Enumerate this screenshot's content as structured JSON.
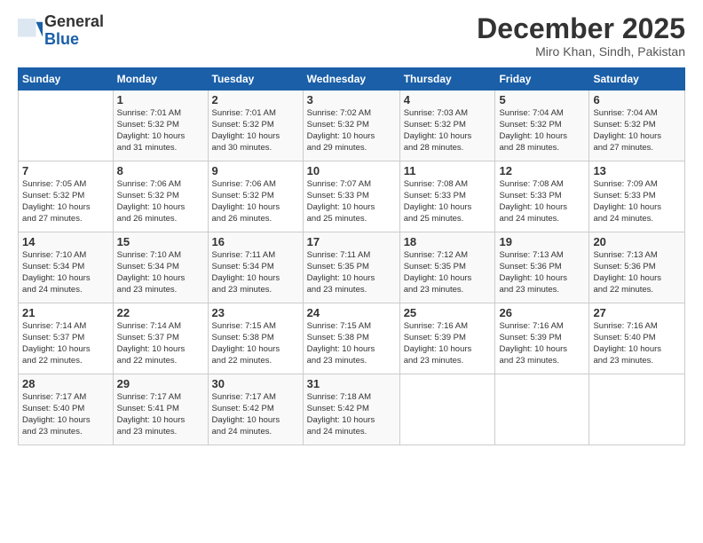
{
  "logo": {
    "general": "General",
    "blue": "Blue"
  },
  "header": {
    "month": "December 2025",
    "location": "Miro Khan, Sindh, Pakistan"
  },
  "days_of_week": [
    "Sunday",
    "Monday",
    "Tuesday",
    "Wednesday",
    "Thursday",
    "Friday",
    "Saturday"
  ],
  "weeks": [
    [
      {
        "day": "",
        "info": ""
      },
      {
        "day": "1",
        "info": "Sunrise: 7:01 AM\nSunset: 5:32 PM\nDaylight: 10 hours\nand 31 minutes."
      },
      {
        "day": "2",
        "info": "Sunrise: 7:01 AM\nSunset: 5:32 PM\nDaylight: 10 hours\nand 30 minutes."
      },
      {
        "day": "3",
        "info": "Sunrise: 7:02 AM\nSunset: 5:32 PM\nDaylight: 10 hours\nand 29 minutes."
      },
      {
        "day": "4",
        "info": "Sunrise: 7:03 AM\nSunset: 5:32 PM\nDaylight: 10 hours\nand 28 minutes."
      },
      {
        "day": "5",
        "info": "Sunrise: 7:04 AM\nSunset: 5:32 PM\nDaylight: 10 hours\nand 28 minutes."
      },
      {
        "day": "6",
        "info": "Sunrise: 7:04 AM\nSunset: 5:32 PM\nDaylight: 10 hours\nand 27 minutes."
      }
    ],
    [
      {
        "day": "7",
        "info": "Sunrise: 7:05 AM\nSunset: 5:32 PM\nDaylight: 10 hours\nand 27 minutes."
      },
      {
        "day": "8",
        "info": "Sunrise: 7:06 AM\nSunset: 5:32 PM\nDaylight: 10 hours\nand 26 minutes."
      },
      {
        "day": "9",
        "info": "Sunrise: 7:06 AM\nSunset: 5:32 PM\nDaylight: 10 hours\nand 26 minutes."
      },
      {
        "day": "10",
        "info": "Sunrise: 7:07 AM\nSunset: 5:33 PM\nDaylight: 10 hours\nand 25 minutes."
      },
      {
        "day": "11",
        "info": "Sunrise: 7:08 AM\nSunset: 5:33 PM\nDaylight: 10 hours\nand 25 minutes."
      },
      {
        "day": "12",
        "info": "Sunrise: 7:08 AM\nSunset: 5:33 PM\nDaylight: 10 hours\nand 24 minutes."
      },
      {
        "day": "13",
        "info": "Sunrise: 7:09 AM\nSunset: 5:33 PM\nDaylight: 10 hours\nand 24 minutes."
      }
    ],
    [
      {
        "day": "14",
        "info": "Sunrise: 7:10 AM\nSunset: 5:34 PM\nDaylight: 10 hours\nand 24 minutes."
      },
      {
        "day": "15",
        "info": "Sunrise: 7:10 AM\nSunset: 5:34 PM\nDaylight: 10 hours\nand 23 minutes."
      },
      {
        "day": "16",
        "info": "Sunrise: 7:11 AM\nSunset: 5:34 PM\nDaylight: 10 hours\nand 23 minutes."
      },
      {
        "day": "17",
        "info": "Sunrise: 7:11 AM\nSunset: 5:35 PM\nDaylight: 10 hours\nand 23 minutes."
      },
      {
        "day": "18",
        "info": "Sunrise: 7:12 AM\nSunset: 5:35 PM\nDaylight: 10 hours\nand 23 minutes."
      },
      {
        "day": "19",
        "info": "Sunrise: 7:13 AM\nSunset: 5:36 PM\nDaylight: 10 hours\nand 23 minutes."
      },
      {
        "day": "20",
        "info": "Sunrise: 7:13 AM\nSunset: 5:36 PM\nDaylight: 10 hours\nand 22 minutes."
      }
    ],
    [
      {
        "day": "21",
        "info": "Sunrise: 7:14 AM\nSunset: 5:37 PM\nDaylight: 10 hours\nand 22 minutes."
      },
      {
        "day": "22",
        "info": "Sunrise: 7:14 AM\nSunset: 5:37 PM\nDaylight: 10 hours\nand 22 minutes."
      },
      {
        "day": "23",
        "info": "Sunrise: 7:15 AM\nSunset: 5:38 PM\nDaylight: 10 hours\nand 22 minutes."
      },
      {
        "day": "24",
        "info": "Sunrise: 7:15 AM\nSunset: 5:38 PM\nDaylight: 10 hours\nand 23 minutes."
      },
      {
        "day": "25",
        "info": "Sunrise: 7:16 AM\nSunset: 5:39 PM\nDaylight: 10 hours\nand 23 minutes."
      },
      {
        "day": "26",
        "info": "Sunrise: 7:16 AM\nSunset: 5:39 PM\nDaylight: 10 hours\nand 23 minutes."
      },
      {
        "day": "27",
        "info": "Sunrise: 7:16 AM\nSunset: 5:40 PM\nDaylight: 10 hours\nand 23 minutes."
      }
    ],
    [
      {
        "day": "28",
        "info": "Sunrise: 7:17 AM\nSunset: 5:40 PM\nDaylight: 10 hours\nand 23 minutes."
      },
      {
        "day": "29",
        "info": "Sunrise: 7:17 AM\nSunset: 5:41 PM\nDaylight: 10 hours\nand 23 minutes."
      },
      {
        "day": "30",
        "info": "Sunrise: 7:17 AM\nSunset: 5:42 PM\nDaylight: 10 hours\nand 24 minutes."
      },
      {
        "day": "31",
        "info": "Sunrise: 7:18 AM\nSunset: 5:42 PM\nDaylight: 10 hours\nand 24 minutes."
      },
      {
        "day": "",
        "info": ""
      },
      {
        "day": "",
        "info": ""
      },
      {
        "day": "",
        "info": ""
      }
    ]
  ]
}
